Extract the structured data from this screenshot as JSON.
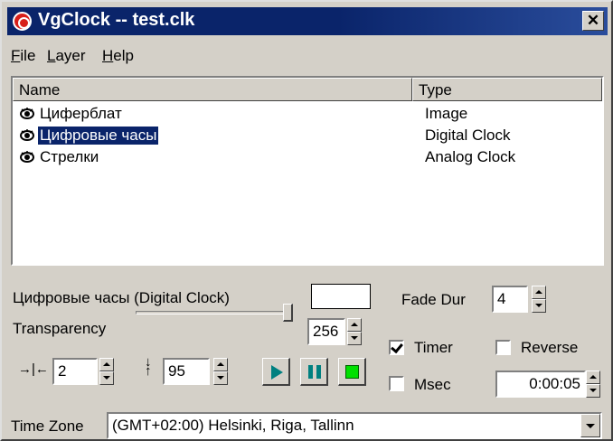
{
  "window": {
    "title": "VgClock -- test.clk",
    "close_glyph": "✕"
  },
  "menu": [
    "File",
    "Layer",
    "Help"
  ],
  "layers": {
    "columns": [
      "Name",
      "Type"
    ],
    "rows": [
      {
        "name": "Циферблат",
        "type": "Image",
        "selected": false
      },
      {
        "name": "Цифровые часы",
        "type": "Digital Clock",
        "selected": true
      },
      {
        "name": "Стрелки",
        "type": "Analog Clock",
        "selected": false
      }
    ]
  },
  "props": {
    "layer_caption": "Цифровые часы (Digital Clock)",
    "fade_dur_label": "Fade Dur",
    "fade_dur_value": "4",
    "transparency_label": "Transparency",
    "transparency_value": "256",
    "transparency_fraction": 1.0,
    "timer_label": "Timer",
    "timer_checked": true,
    "reverse_label": "Reverse",
    "reverse_checked": false,
    "msec_label": "Msec",
    "msec_checked": false,
    "duration_value": "0:00:05",
    "x_offset_value": "2",
    "y_offset_value": "95",
    "swatch_color": "#ffffff"
  },
  "timezone": {
    "label": "Time Zone",
    "value": "(GMT+02:00) Helsinki, Riga, Tallinn"
  },
  "colors": {
    "title_bar": "#0a246a",
    "play_teal": "#008080",
    "stop_green": "#00e000"
  }
}
